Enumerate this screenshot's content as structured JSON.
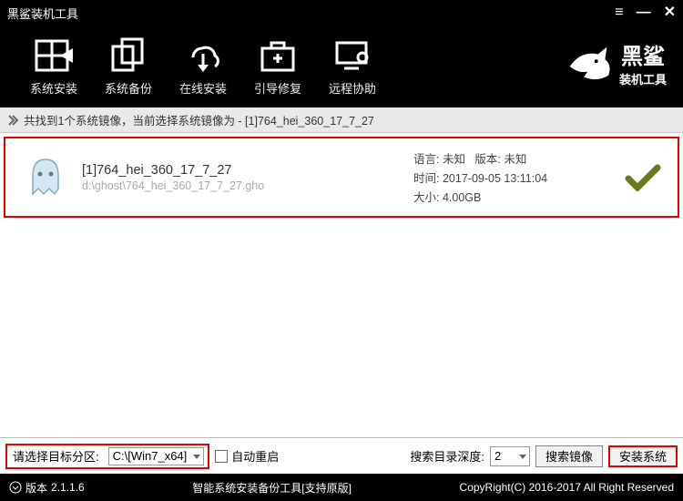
{
  "titlebar": {
    "title": "黑鲨装机工具"
  },
  "toolbar": {
    "items": [
      {
        "label": "系统安装"
      },
      {
        "label": "系统备份"
      },
      {
        "label": "在线安装"
      },
      {
        "label": "引导修复"
      },
      {
        "label": "远程协助"
      }
    ]
  },
  "brand": {
    "name": "黑鲨",
    "sub": "装机工具"
  },
  "infobar": {
    "text": "共找到1个系统镜像，当前选择系统镜像为 - [1]764_hei_360_17_7_27"
  },
  "images": [
    {
      "name": "[1]764_hei_360_17_7_27",
      "path": "d:\\ghost\\764_hei_360_17_7_27.gho",
      "lang_label": "语言:",
      "lang_value": "未知",
      "version_label": "版本:",
      "version_value": "未知",
      "time_label": "时间:",
      "time_value": "2017-09-05 13:11:04",
      "size_label": "大小:",
      "size_value": "4.00GB"
    }
  ],
  "bottombar": {
    "partition_label": "请选择目标分区:",
    "partition_value": "C:\\[Win7_x64]",
    "auto_reboot_label": "自动重启",
    "depth_label": "搜索目录深度:",
    "depth_value": "2",
    "search_btn": "搜索镜像",
    "install_btn": "安装系统"
  },
  "statusbar": {
    "version_label": "版本",
    "version_value": "2.1.1.6",
    "center": "智能系统安装备份工具[支持原版]",
    "right": "CopyRight(C) 2016-2017 All Right Reserved"
  }
}
